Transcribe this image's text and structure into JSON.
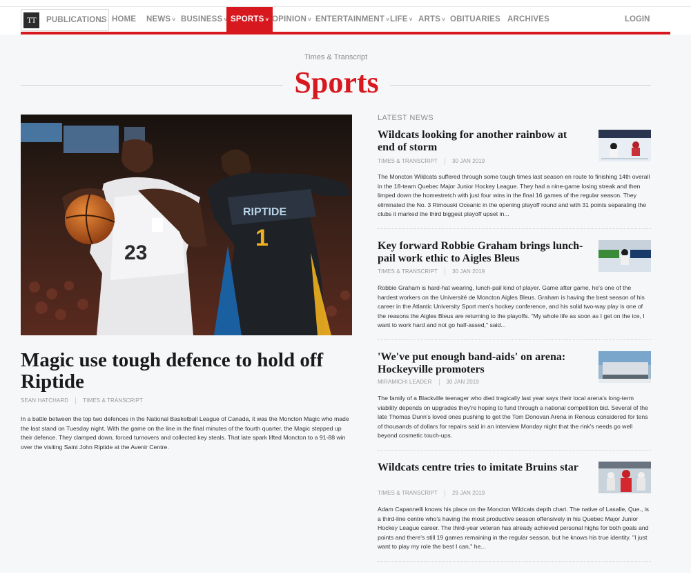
{
  "nav": {
    "brand_logo": "TT",
    "publications_label": "PUBLICATIONS",
    "items": [
      {
        "label": "HOME",
        "dropdown": false
      },
      {
        "label": "NEWS",
        "dropdown": true
      },
      {
        "label": "BUSINESS",
        "dropdown": true
      },
      {
        "label": "SPORTS",
        "dropdown": true,
        "active": true
      },
      {
        "label": "OPINION",
        "dropdown": true
      },
      {
        "label": "ENTERTAINMENT",
        "dropdown": true
      },
      {
        "label": "LIFE",
        "dropdown": true
      },
      {
        "label": "ARTS",
        "dropdown": true
      },
      {
        "label": "OBITUARIES",
        "dropdown": false
      },
      {
        "label": "ARCHIVES",
        "dropdown": false
      }
    ],
    "login_label": "LOGIN",
    "accent_color": "#d7191f"
  },
  "header": {
    "site_name": "Times & Transcript",
    "section_title": "Sports"
  },
  "lead": {
    "headline": "Magic use tough defence to hold off Riptide",
    "author": "SEAN HATCHARD",
    "source": "TIMES & TRANSCRIPT",
    "summary": "In a battle between the top two defences in the National Basketball League of Canada, it was the Moncton Magic who made the last stand on Tuesday night. With the game on the line in the final minutes of the fourth quarter, the Magic stepped up their defence. They clamped down, forced turnovers and collected key steals. That late spark lifted Moncton to a 91-88 win over the visiting Saint John Riptide at the Avenir Centre.",
    "photo": {
      "jersey_left": "23",
      "jersey_right": "1",
      "team_right": "RIPTIDE"
    }
  },
  "latest": {
    "label": "LATEST NEWS",
    "stories": [
      {
        "title": "Wildcats looking for another rainbow at end of storm",
        "source": "TIMES & TRANSCRIPT",
        "date": "30 JAN 2019",
        "summary": "The Moncton Wildcats suffered through some tough times last season en route to finishing 14th overall in the 18-team Quebec Major Junior Hockey League. They had a nine-game losing streak and then limped down the homestretch with just four wins in the final 16 games of the regular season. They eliminated the No. 3 Rimouski Oceanic in the opening playoff round and with 31 points separating the clubs it marked the third biggest playoff upset in..."
      },
      {
        "title": "Key forward Robbie Graham brings lunch-pail work ethic to Aigles Bleus",
        "source": "TIMES & TRANSCRIPT",
        "date": "30 JAN 2019",
        "summary": "Robbie Graham is hard-hat wearing, lunch-pail kind of player. Game after game, he's one of the hardest workers on the Université de Moncton Aigles Bleus. Graham is having the best season of his career in the Atlantic University Sport men's hockey conference, and his solid two-way play is one of the reasons the Aigles Bleus are returning to the playoffs. \"My whole life as soon as I get on the ice, I want to work hard and not go half-assed,\" said..."
      },
      {
        "title": "'We've put enough band-aids' on arena: Hockeyville promoters",
        "source": "MIRAMICHI LEADER",
        "date": "30 JAN 2019",
        "summary": "The family of a Blackville teenager who died tragically last year says their local arena's long-term viability depends on upgrades they're hoping to fund through a national competition bid. Several of the late Thomas Dunn's loved ones pushing to get the Tom Donovan Arena in Renous considered for tens of thousands of dollars for repairs said in an interview Monday night that the rink's needs go well beyond cosmetic touch-ups."
      },
      {
        "title": "Wildcats centre tries to imitate Bruins star",
        "source": "TIMES & TRANSCRIPT",
        "date": "29 JAN 2019",
        "summary": "Adam Capannelli knows his place on the Moncton Wildcats depth chart. The native of Lasalle, Que., is a third-line centre who's having the most productive season offensively in his Quebec Major Junior Hockey League career. The third-year veteran has already achieved personal highs for both goals and points and there's still 19 games remaining in the regular season, but he knows his true identity. \"I just want to play my role the best I can,\" he..."
      }
    ]
  }
}
